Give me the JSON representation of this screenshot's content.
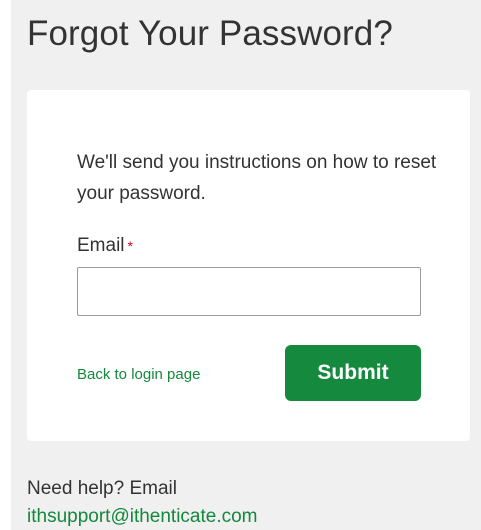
{
  "page": {
    "title": "Forgot Your Password?"
  },
  "form": {
    "intro": "We'll send you instructions on how to reset your password.",
    "email_label": "Email",
    "required_marker": "*",
    "email_value": "",
    "back_link": "Back to login page",
    "submit_label": "Submit"
  },
  "help": {
    "text": "Need help? Email",
    "email": "ithsupport@ithenticate.com"
  },
  "colors": {
    "accent": "#158a3e",
    "link": "#14883c",
    "required": "#d0021b",
    "background": "#f0f0f0",
    "text": "#333333"
  }
}
